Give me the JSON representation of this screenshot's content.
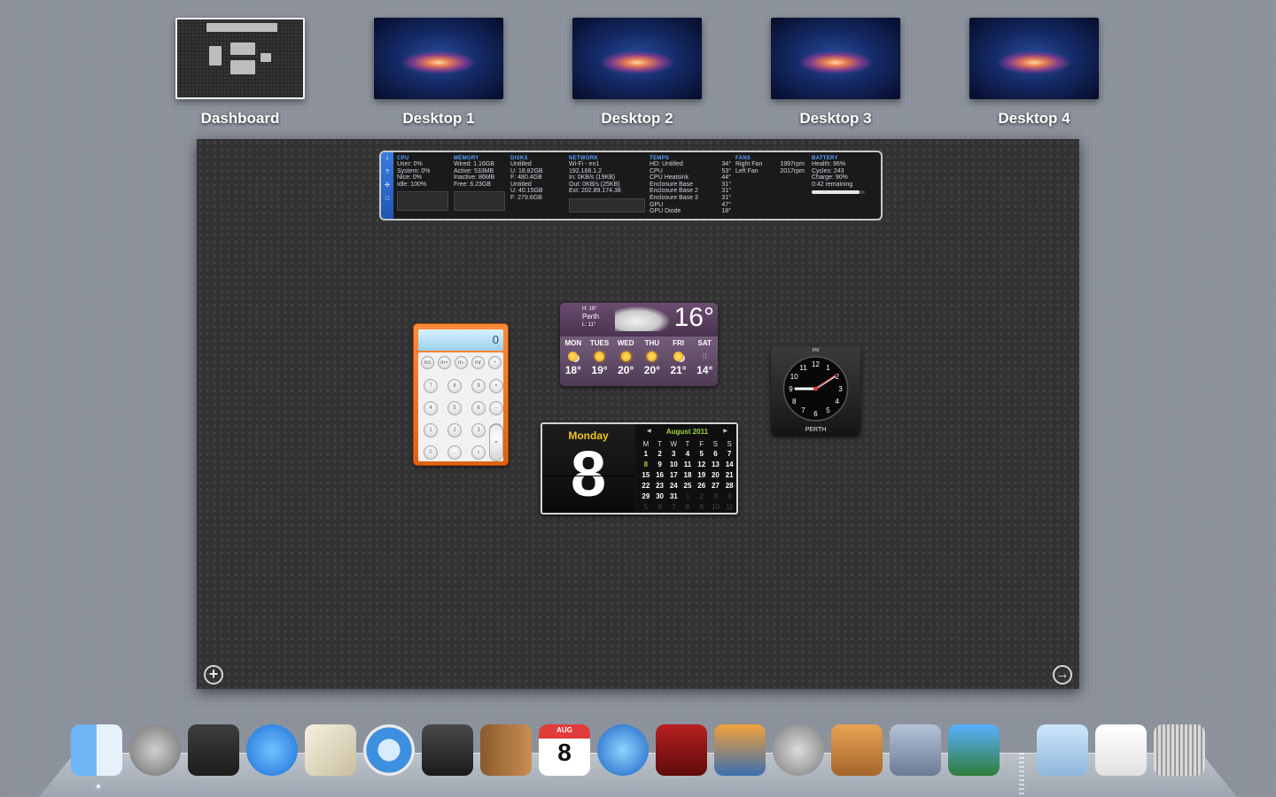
{
  "spaces": [
    {
      "label": "Dashboard",
      "type": "dashboard"
    },
    {
      "label": "Desktop 1",
      "type": "desktop"
    },
    {
      "label": "Desktop 2",
      "type": "desktop"
    },
    {
      "label": "Desktop 3",
      "type": "desktop"
    },
    {
      "label": "Desktop 4",
      "type": "desktop"
    }
  ],
  "istat": {
    "cpu": {
      "title": "CPU",
      "lines": [
        "User: 0%",
        "System: 0%",
        "Nice: 0%",
        "Idle: 100%"
      ]
    },
    "memory": {
      "title": "MEMORY",
      "lines": [
        "Wired: 1.16GB",
        "Active: 533MB",
        "Inactive: 86MB",
        "Free: 6.23GB"
      ]
    },
    "disks": {
      "title": "DISKS",
      "lines": [
        "Untitled",
        "U: 18.82GB",
        "F: 480.4GB",
        "",
        "Untitled",
        "U: 40.15GB",
        "F: 279.6GB"
      ]
    },
    "network": {
      "title": "NETWORK",
      "lines": [
        "Wi-Fi - en1",
        "192.168.1.2",
        "In: 0KB/s (19KB)",
        "Out: 0KB/s (25KB)",
        "Ext: 202.89.174.38"
      ]
    },
    "temps": {
      "title": "TEMPS",
      "lines": [
        [
          "HD: Untitled",
          "34°"
        ],
        [
          "CPU",
          "53°"
        ],
        [
          "CPU Heatsink",
          "44°"
        ],
        [
          "Enclosure Base",
          "31°"
        ],
        [
          "Enclosure Base 2",
          "31°"
        ],
        [
          "Enclosure Base 3",
          "31°"
        ],
        [
          "GPU",
          "47°"
        ],
        [
          "GPU Diode",
          "18°"
        ]
      ]
    },
    "fans": {
      "title": "FANS",
      "lines": [
        [
          "Right Fan",
          "1997rpm"
        ],
        [
          "Left Fan",
          "2017rpm"
        ]
      ]
    },
    "battery": {
      "title": "BATTERY",
      "lines": [
        "Health: 96%",
        "Cycles: 243",
        "Charge: 90%",
        "0:42 remaining"
      ],
      "charge_fraction": 0.9
    }
  },
  "weather": {
    "city": "Perth",
    "high": "H: 18°",
    "low": "L: 11°",
    "temp": "16°",
    "forecast": [
      {
        "day": "MON",
        "temp": "18°",
        "icon": "sun-cloud-icon"
      },
      {
        "day": "TUES",
        "temp": "19°",
        "icon": "sun-icon"
      },
      {
        "day": "WED",
        "temp": "20°",
        "icon": "sun-icon"
      },
      {
        "day": "THU",
        "temp": "20°",
        "icon": "sun-icon"
      },
      {
        "day": "FRI",
        "temp": "21°",
        "icon": "sun-cloud-icon"
      },
      {
        "day": "SAT",
        "temp": "14°",
        "icon": "rain-icon"
      }
    ]
  },
  "calculator": {
    "display": "0",
    "keys": [
      [
        "mc",
        "m+",
        "m-",
        "mr",
        "÷"
      ],
      [
        "7",
        "8",
        "9",
        "×"
      ],
      [
        "4",
        "5",
        "6",
        "−"
      ],
      [
        "1",
        "2",
        "3",
        "+"
      ],
      [
        "0",
        ".",
        "c",
        "="
      ]
    ]
  },
  "calendar": {
    "day_name": "Monday",
    "day_number": "8",
    "month": "August 2011",
    "weekdays": [
      "M",
      "T",
      "W",
      "T",
      "F",
      "S",
      "S"
    ],
    "cells": [
      "1",
      "2",
      "3",
      "4",
      "5",
      "6",
      "7",
      "8",
      "9",
      "10",
      "11",
      "12",
      "13",
      "14",
      "15",
      "16",
      "17",
      "18",
      "19",
      "20",
      "21",
      "22",
      "23",
      "24",
      "25",
      "26",
      "27",
      "28",
      "29",
      "30",
      "31",
      "1",
      "2",
      "3",
      "4",
      "5",
      "6",
      "7",
      "8",
      "9",
      "10",
      "11"
    ],
    "today": "8",
    "month_days": 31
  },
  "clock": {
    "ampm": "PM",
    "city": "PERTH",
    "numbers": [
      "12",
      "1",
      "2",
      "3",
      "4",
      "5",
      "6",
      "7",
      "8",
      "9",
      "10",
      "11"
    ]
  },
  "dashboard_controls": {
    "add": "+",
    "next": "→"
  },
  "dock": [
    {
      "name": "Finder",
      "icon": "finder-icon",
      "running": true
    },
    {
      "name": "Launchpad",
      "icon": "launchpad-icon"
    },
    {
      "name": "Mission Control",
      "icon": "mission-control-icon"
    },
    {
      "name": "App Store",
      "icon": "app-store-icon"
    },
    {
      "name": "Mail",
      "icon": "mail-icon"
    },
    {
      "name": "Safari",
      "icon": "safari-icon"
    },
    {
      "name": "FaceTime",
      "icon": "facetime-icon"
    },
    {
      "name": "Address Book",
      "icon": "address-book-icon"
    },
    {
      "name": "iCal",
      "icon": "ical-icon",
      "label_top": "AUG",
      "label_num": "8"
    },
    {
      "name": "iTunes",
      "icon": "itunes-icon"
    },
    {
      "name": "Photo Booth",
      "icon": "photo-booth-icon"
    },
    {
      "name": "iPhoto",
      "icon": "iphoto-icon"
    },
    {
      "name": "System Preferences",
      "icon": "system-preferences-icon"
    },
    {
      "name": "Keynote",
      "icon": "keynote-icon"
    },
    {
      "name": "Pages",
      "icon": "pages-icon"
    },
    {
      "name": "Numbers",
      "icon": "numbers-icon"
    },
    {
      "name": "Applications",
      "icon": "folder-icon"
    },
    {
      "name": "Document",
      "icon": "document-icon"
    },
    {
      "name": "Trash",
      "icon": "trash-icon"
    }
  ]
}
